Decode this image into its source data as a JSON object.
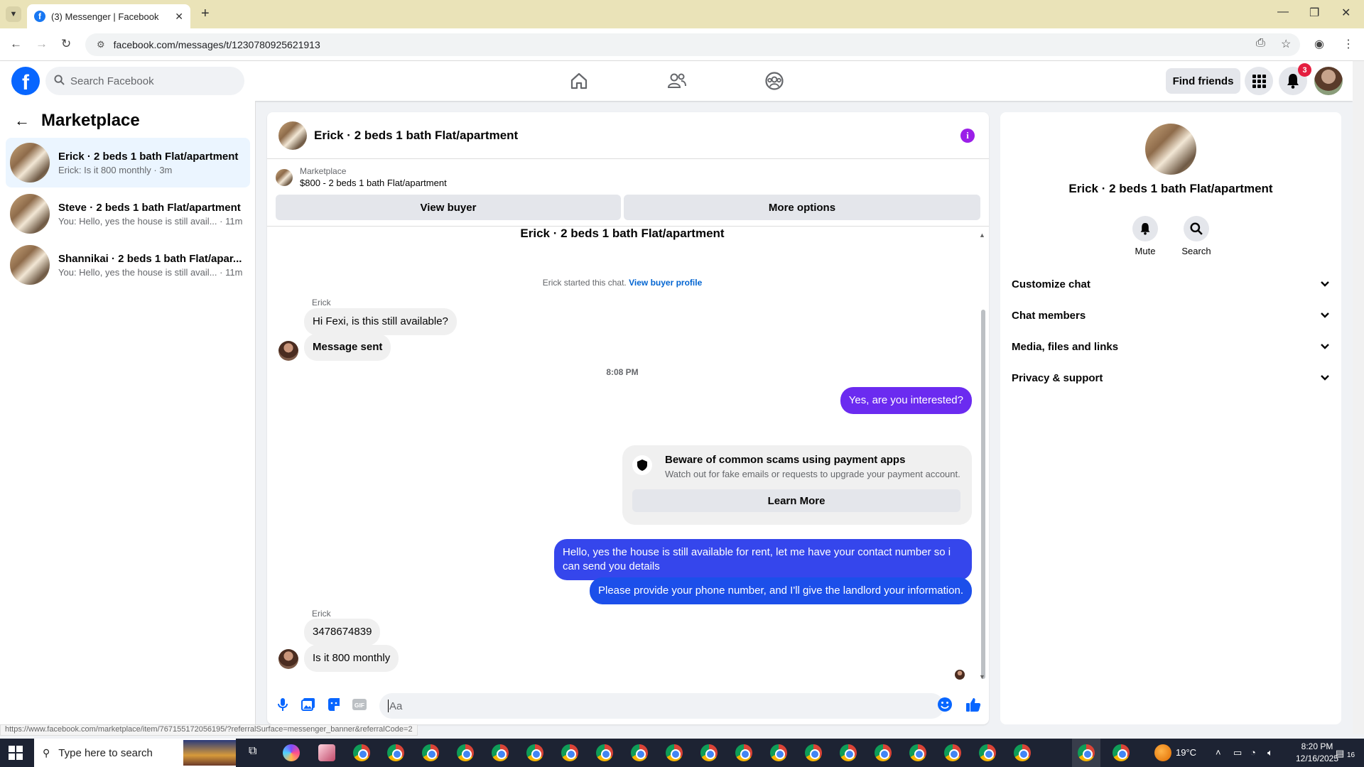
{
  "browser": {
    "tab_title": "(3) Messenger | Facebook",
    "url": "facebook.com/messages/t/1230780925621913",
    "status_url": "https://www.facebook.com/marketplace/item/767155172056195/?referralSurface=messenger_banner&referralCode=2"
  },
  "header": {
    "search_placeholder": "Search Facebook",
    "find_friends": "Find friends",
    "notification_count": "3"
  },
  "sidebar": {
    "title": "Marketplace",
    "conversations": [
      {
        "name": "Erick · 2 beds 1 bath Flat/apartment",
        "preview": "Erick: Is it 800 monthly · 3m"
      },
      {
        "name": "Steve · 2 beds 1 bath Flat/apartment",
        "preview": "You: Hello, yes the house is still avail... · 11m"
      },
      {
        "name": "Shannikai · 2 beds 1 bath Flat/apar...",
        "preview": "You: Hello, yes the house is still avail... · 11m"
      }
    ]
  },
  "chat": {
    "title": "Erick · 2 beds 1 bath Flat/apartment",
    "marketplace_label": "Marketplace",
    "listing": "$800 - 2 beds 1 bath Flat/apartment",
    "view_buyer": "View buyer",
    "more_options": "More options",
    "thread_title": "Erick · 2 beds 1 bath Flat/apartment",
    "started_text": "Erick started this chat.",
    "view_buyer_profile": "View buyer profile",
    "sender_1": "Erick",
    "msg_1": "Hi Fexi, is this still available?",
    "msg_2": "Message sent",
    "timestamp": "8:08 PM",
    "msg_3": "Yes, are you interested?",
    "scam_title": "Beware of common scams using payment apps",
    "scam_desc": "Watch out for fake emails or requests to upgrade your payment account.",
    "learn_more": "Learn More",
    "msg_4": "Hello, yes the house is still available for rent, let me have your contact number so i can send you details",
    "msg_5": "Please provide your phone number, and I'll give the landlord your information.",
    "sender_2": "Erick",
    "msg_6": "3478674839",
    "msg_7": "Is it 800 monthly",
    "composer_placeholder": "Aa"
  },
  "details": {
    "name": "Erick · 2 beds 1 bath Flat/apartment",
    "mute": "Mute",
    "search": "Search",
    "sections": [
      "Customize chat",
      "Chat members",
      "Media, files and links",
      "Privacy & support"
    ]
  },
  "taskbar": {
    "search_placeholder": "Type here to search",
    "weather": "19°C",
    "time": "8:20 PM",
    "date": "12/16/2025",
    "notif_count": "16"
  },
  "colors": {
    "brand": "#0866ff",
    "bubble_purple": "#6b2bf0",
    "bubble_blue": "#1c4fea",
    "accent_purple": "#9b1fe8"
  }
}
